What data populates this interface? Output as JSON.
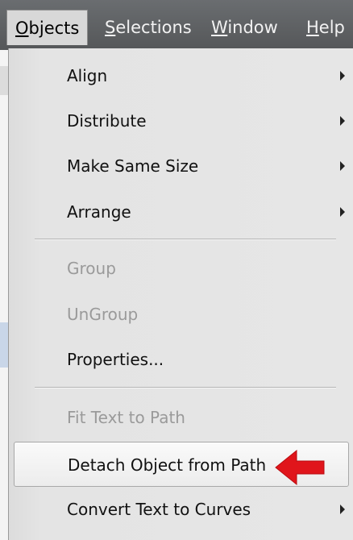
{
  "menubar": {
    "items": [
      {
        "mnemonic": "O",
        "rest": "bjects"
      },
      {
        "mnemonic": "S",
        "rest": "elections"
      },
      {
        "mnemonic": "W",
        "rest": "indow"
      },
      {
        "mnemonic": "H",
        "rest": "elp"
      }
    ]
  },
  "menu": {
    "items": [
      {
        "label": "Align",
        "state": "enabled",
        "has_submenu": true
      },
      {
        "label": "Distribute",
        "state": "enabled",
        "has_submenu": true
      },
      {
        "label": "Make Same Size",
        "state": "enabled",
        "has_submenu": true
      },
      {
        "label": "Arrange",
        "state": "enabled",
        "has_submenu": true
      },
      {
        "label": "Group",
        "state": "disabled",
        "has_submenu": false
      },
      {
        "label": "UnGroup",
        "state": "disabled",
        "has_submenu": false
      },
      {
        "label": "Properties...",
        "state": "enabled",
        "has_submenu": false
      },
      {
        "label": "Fit Text to Path",
        "state": "disabled",
        "has_submenu": false
      },
      {
        "label": "Detach Object from Path",
        "state": "highlighted",
        "has_submenu": false
      },
      {
        "label": "Convert Text to Curves",
        "state": "enabled",
        "has_submenu": true
      }
    ]
  },
  "annotation": {
    "icon": "red-arrow-icon",
    "color": "#e0151b"
  },
  "colors": {
    "menubar_bg": "#5f6163",
    "menu_bg": "#e4e4e4",
    "disabled_text": "#9a9a9a"
  }
}
